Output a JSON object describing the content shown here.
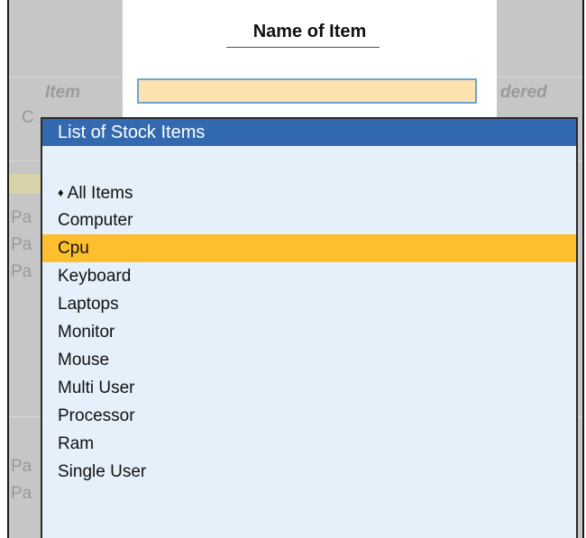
{
  "background": {
    "col_item_header": "Item",
    "col_ordered_header": "dered",
    "left_fragment_top": "C",
    "left_rows": [
      "Pa",
      "Pa",
      "Pa",
      "Pa",
      "Pa"
    ]
  },
  "name_dialog": {
    "title": "Name of Item",
    "input_value": ""
  },
  "stock_list": {
    "title": "List of Stock Items",
    "items": [
      {
        "label": "All Items",
        "marker": "♦"
      },
      {
        "label": "Computer"
      },
      {
        "label": "Cpu",
        "selected": true
      },
      {
        "label": "Keyboard"
      },
      {
        "label": "Laptops"
      },
      {
        "label": "Monitor"
      },
      {
        "label": "Mouse"
      },
      {
        "label": "Multi User"
      },
      {
        "label": "Processor"
      },
      {
        "label": "Ram"
      },
      {
        "label": "Single User"
      }
    ]
  },
  "colors": {
    "header_blue": "#336aaf",
    "selection": "#fdbf2d",
    "list_bg": "#e5f0fb",
    "input_bg": "#ffe3ae"
  }
}
